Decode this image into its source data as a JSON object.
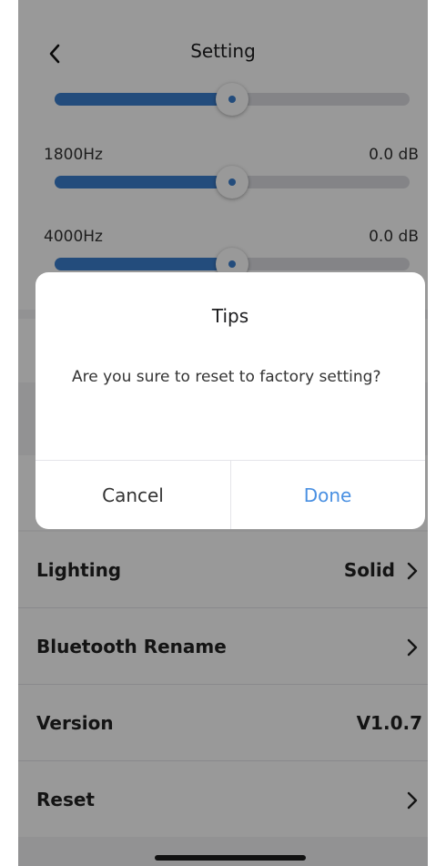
{
  "header": {
    "title": "Setting"
  },
  "equalizer": {
    "bands": [
      {
        "label": "",
        "value_text": "",
        "level_fraction": 0.5
      },
      {
        "label": "1800Hz",
        "value_text": "0.0 dB",
        "level_fraction": 0.5
      },
      {
        "label": "4000Hz",
        "value_text": "0.0 dB",
        "level_fraction": 0.5
      }
    ]
  },
  "settings": {
    "lighting": {
      "label": "Lighting",
      "value": "Solid"
    },
    "bluetooth_rename": {
      "label": "Bluetooth Rename"
    },
    "version": {
      "label": "Version",
      "value": "V1.0.7"
    },
    "reset": {
      "label": "Reset"
    }
  },
  "dialog": {
    "title": "Tips",
    "message": "Are you sure to reset to factory setting?",
    "cancel_label": "Cancel",
    "done_label": "Done"
  },
  "colors": {
    "accent": "#3b7fcf",
    "done_text": "#4a90e2",
    "overlay": "rgba(0,0,0,0.40)"
  },
  "icons": {
    "back": "chevron-left-icon",
    "row_arrow": "chevron-right-icon"
  }
}
